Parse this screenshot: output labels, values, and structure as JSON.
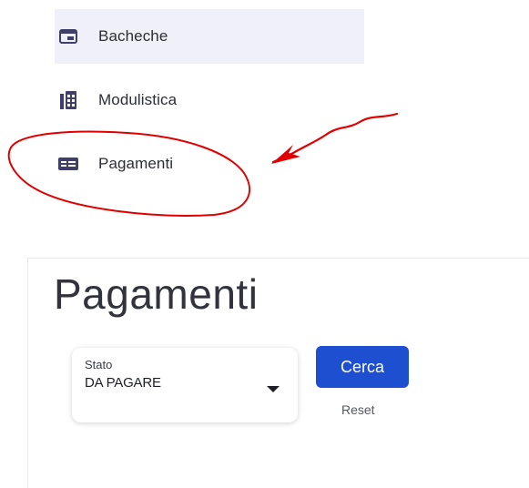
{
  "sidebar": {
    "items": [
      {
        "label": "Bacheche",
        "icon": "card-icon",
        "active": true
      },
      {
        "label": "Modulistica",
        "icon": "building-icon",
        "active": false
      },
      {
        "label": "Pagamenti",
        "icon": "payment-card-icon",
        "active": false
      }
    ]
  },
  "page": {
    "title": "Pagamenti",
    "filter": {
      "label": "Stato",
      "value": "DA PAGARE"
    },
    "search_button_label": "Cerca",
    "reset_label": "Reset"
  },
  "colors": {
    "accent": "#1f4fd1",
    "annotation": "#e10000",
    "active_item_bg": "#f0f0f8"
  }
}
